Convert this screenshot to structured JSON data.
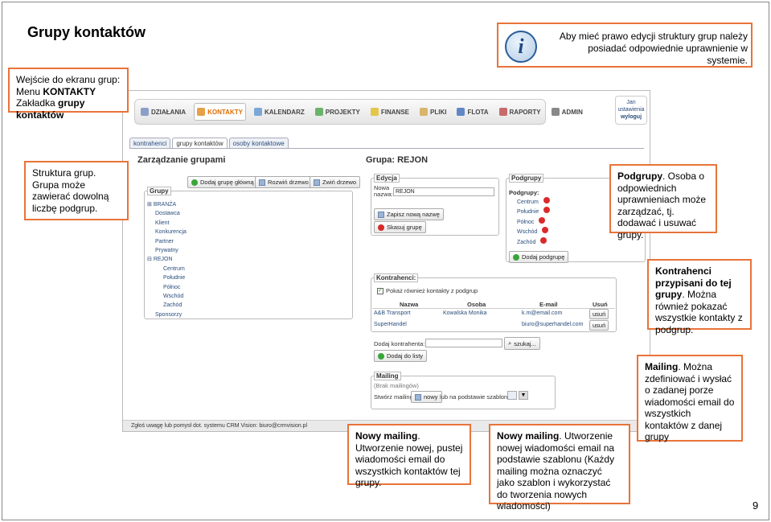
{
  "title": "Grupy kontaktów",
  "info": {
    "text": "Aby mieć prawo edycji struktury grup należy posiadać odpowiednie uprawnienie w systemie.",
    "icon": "info-icon"
  },
  "callouts": {
    "entry": {
      "line1": "Wejście do ekranu grup:",
      "line2": "Menu ",
      "line2b": "KONTAKTY",
      "line3": "Zakładka ",
      "line3b": "grupy kontaktów"
    },
    "structure": "Struktura grup. Grupa może zawierać dowolną liczbę podgrup.",
    "subgroups": {
      "bold": "Podgrupy",
      "rest": ". Osoba o odpowiednich uprawnieniach może zarządzać, tj. dodawać i usuwać grupy."
    },
    "contractors": {
      "bold": "Kontrahenci przypisani do tej grupy",
      "rest": ". Można również pokazać wszystkie kontakty z podgrup."
    },
    "mailing": {
      "bold": "Mailing",
      "rest": ". Można zdefiniować i wysłać o zadanej porze wiadomości email do wszystkich kontaktów z danej grupy"
    },
    "new_mailing": {
      "bold": "Nowy mailing",
      "rest": ". Utworzenie nowej, pustej wiadomości email do wszystkich kontaktów tej grupy."
    },
    "new_mailing_template": {
      "bold": "Nowy mailing",
      "rest": ". Utworzenie nowej wiadomości email na podstawie szablonu (Każdy mailing można oznaczyć jako szablon i wykorzystać do tworzenia nowych wiadomości)"
    }
  },
  "app": {
    "nav": [
      "DZIAŁANIA",
      "KONTAKTY",
      "KALENDARZ",
      "PROJEKTY",
      "FINANSE",
      "PLIKI",
      "FLOTA",
      "RAPORTY",
      "ADMIN"
    ],
    "user": {
      "line1": "Jan",
      "line2": "ustawienia",
      "line3": "wyloguj"
    },
    "tabs": [
      "kontrahenci",
      "grupy kontaktów",
      "osoby kontaktowe"
    ],
    "left_title": "Zarządzanie grupami",
    "btn_add_main": "Dodaj grupę główną",
    "btn_expand": "Rozwiń drzewo",
    "btn_collapse": "Zwiń drzewo",
    "groups_legend": "Grupy",
    "tree": [
      "BRANŻA",
      "Dostawca",
      "Klient",
      "Konkurencja",
      "Partner",
      "Prywatny",
      "REJON",
      "Centrum",
      "Południe",
      "Północ",
      "Wschód",
      "Zachód",
      "Sponsorzy"
    ],
    "right_title": "Grupa: REJON",
    "edit_legend": "Edycja",
    "name_label1": "Nowa",
    "name_label2": "nazwa:",
    "name_value": "REJON",
    "btn_save": "Zapisz nową nazwę",
    "btn_delete": "Skasuj grupę",
    "sub_legend": "Podgrupy",
    "sub_label": "Podgrupy:",
    "subgroups": [
      "Centrum",
      "Południe",
      "Północ",
      "Wschód",
      "Zachód"
    ],
    "btn_add_sub": "Dodaj podgrupę",
    "contr_legend": "Kontrahenci:",
    "show_all": "Pokaż również kontakty z podgrup",
    "table_headers": [
      "Nazwa",
      "Osoba",
      "E-mail",
      "Usuń"
    ],
    "rows": [
      {
        "name": "A&B Transport",
        "person": "Kowalska Monika",
        "email": "k.m@email.com",
        "remove": "usuń"
      },
      {
        "name": "SuperHandel",
        "person": "",
        "email": "biuro@superhandel.com",
        "remove": "usuń"
      }
    ],
    "add_contr_label": "Dodaj kontrahenta:",
    "btn_search": "szukaj...",
    "btn_add_list": "Dodaj do listy",
    "mailing_legend": "Mailing",
    "no_mailings": "(Brak mailingów)",
    "create_label": "Stwórz mailing",
    "btn_new": "nowy",
    "template_label": "lub na podstawie szablonu:",
    "status": "Zgłoś uwagę lub pomysł dot. systemu CRM Vision: biuro@crmvision.pl"
  },
  "page_number": "9",
  "colors": {
    "callout_border": "#e8733a",
    "link": "#2a4d7c",
    "active_nav": "#e06d00"
  }
}
